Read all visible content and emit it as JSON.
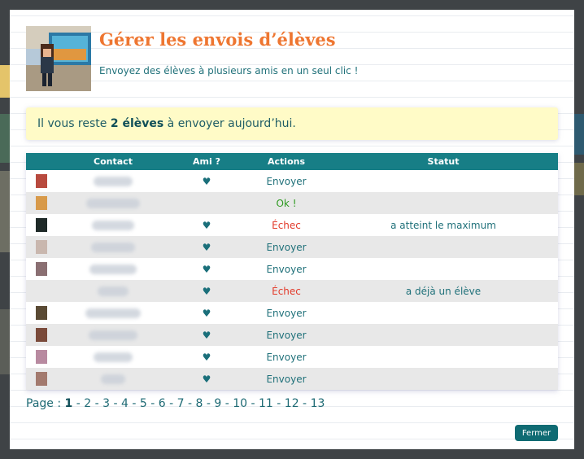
{
  "header": {
    "title": "Gérer les envois d’élèves",
    "subtitle": "Envoyez des élèves à plusieurs amis en un seul clic !"
  },
  "notice": {
    "prefix": "Il vous reste",
    "count": "2 élèves",
    "suffix": "à envoyer aujourd’hui."
  },
  "table": {
    "headers": [
      "",
      "Contact",
      "Ami ?",
      "Actions",
      "Statut"
    ],
    "rows": [
      {
        "contact": "Aribbia",
        "ami": "♥",
        "action": "Envoyer",
        "action_type": "send",
        "statut": "",
        "avatar_color": "#b84a3e",
        "name_len": 48
      },
      {
        "contact": "AnaUlrycks",
        "ami": "",
        "action": "Ok !",
        "action_type": "ok",
        "statut": "",
        "avatar_color": "#d89a4a",
        "name_len": 66
      },
      {
        "contact": "Anamca",
        "ami": "♥",
        "action": "Échec",
        "action_type": "fail",
        "statut": "a atteint le maximum",
        "avatar_color": "#1f2a28",
        "name_len": 52
      },
      {
        "contact": "Ardittina",
        "ami": "♥",
        "action": "Envoyer",
        "action_type": "send",
        "statut": "",
        "avatar_color": "#c9b7ae",
        "name_len": 54
      },
      {
        "contact": "Isabonne",
        "ami": "♥",
        "action": "Envoyer",
        "action_type": "send",
        "statut": "",
        "avatar_color": "#8a6f72",
        "name_len": 58
      },
      {
        "contact": "Karyn",
        "ami": "♥",
        "action": "Échec",
        "action_type": "fail",
        "statut": "a déjà un élève",
        "avatar_color": "",
        "name_len": 38
      },
      {
        "contact": "Beelfinyois",
        "ami": "♥",
        "action": "Envoyer",
        "action_type": "send",
        "statut": "",
        "avatar_color": "#5a4a34",
        "name_len": 68
      },
      {
        "contact": "Bergil71",
        "ami": "♥",
        "action": "Envoyer",
        "action_type": "send",
        "statut": "",
        "avatar_color": "#7a4a3a",
        "name_len": 60
      },
      {
        "contact": "Bdikeal",
        "ami": "♥",
        "action": "Envoyer",
        "action_type": "send",
        "statut": "",
        "avatar_color": "#b88aa0",
        "name_len": 48
      },
      {
        "contact": "Bigo",
        "ami": "♥",
        "action": "Envoyer",
        "action_type": "send",
        "statut": "",
        "avatar_color": "#a37a6e",
        "name_len": 30
      }
    ]
  },
  "pagination": {
    "label": "Page :",
    "current": "1",
    "pages": [
      "2",
      "3",
      "4",
      "5",
      "6",
      "7",
      "8",
      "9",
      "10",
      "11",
      "12",
      "13"
    ]
  },
  "footer": {
    "close_label": "Fermer"
  },
  "colors": {
    "accent": "#ee7631",
    "teal": "#177e86",
    "fail": "#e23a2a",
    "ok": "#2f9a22"
  }
}
